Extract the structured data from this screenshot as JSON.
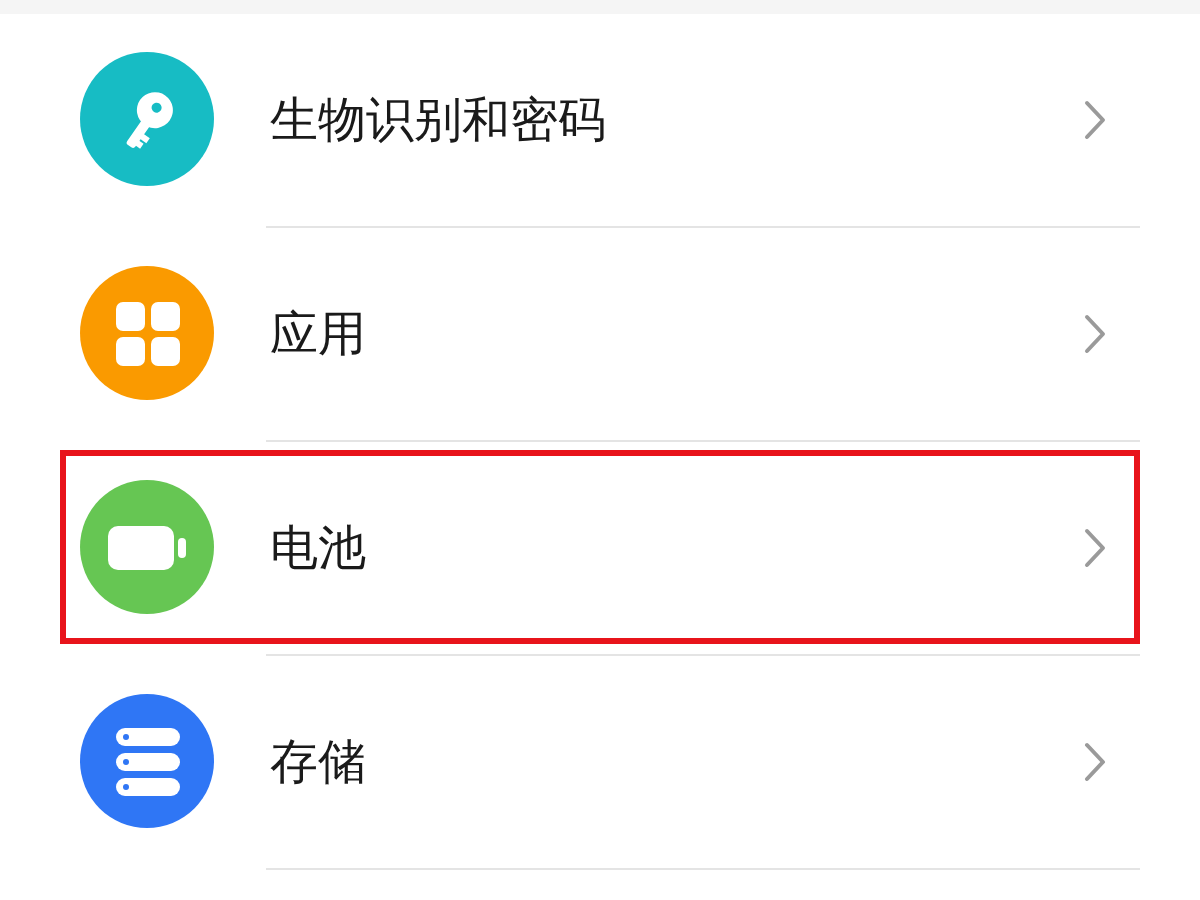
{
  "settings_list": [
    {
      "label": "生物识别和密码",
      "kind": "key",
      "color": "#17bcc4",
      "highlighted": false
    },
    {
      "label": "应用",
      "kind": "apps",
      "color": "#fa9a00",
      "highlighted": false
    },
    {
      "label": "电池",
      "kind": "battery",
      "color": "#66c653",
      "highlighted": true
    },
    {
      "label": "存储",
      "kind": "storage",
      "color": "#2f76f5",
      "highlighted": false
    }
  ]
}
